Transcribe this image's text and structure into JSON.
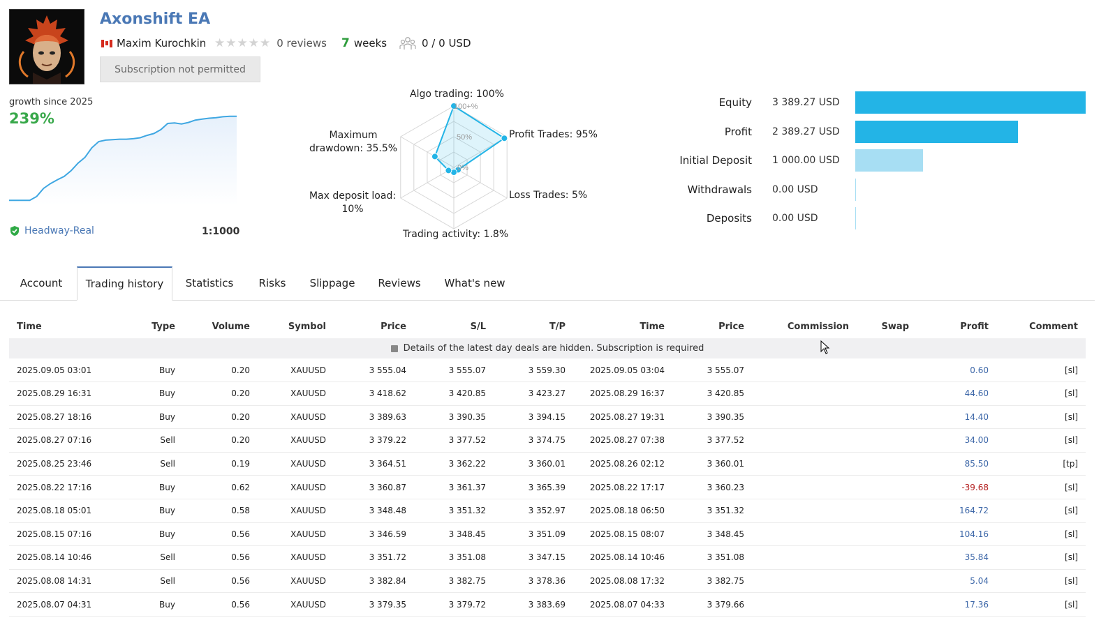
{
  "header": {
    "title": "Axonshift EA",
    "author": "Maxim Kurochkin",
    "reviews": "0 reviews",
    "weeks_num": "7",
    "weeks_label": "weeks",
    "subscribers": "0 / 0 USD",
    "subscription_button": "Subscription not permitted",
    "rating": 0
  },
  "growth": {
    "caption": "growth since 2025",
    "value": "239%",
    "broker": "Headway-Real",
    "leverage": "1:1000"
  },
  "radar": {
    "labels": {
      "algo": "Algo trading: 100%",
      "profit_trades": "Profit Trades: 95%",
      "loss_trades": "Loss Trades: 5%",
      "activity": "Trading activity: 1.8%",
      "deposit_load_1": "Max deposit load:",
      "deposit_load_2": "10%",
      "drawdown_1": "Maximum",
      "drawdown_2": "drawdown: 35.5%"
    },
    "scale": {
      "top": "100+%",
      "mid": "50%",
      "zero": "0%"
    }
  },
  "chart_data": [
    {
      "type": "line",
      "title": "",
      "series": [
        {
          "values": [
            100,
            100,
            100,
            100,
            108,
            125,
            135,
            143,
            150,
            162,
            178,
            190,
            210,
            223,
            226,
            227,
            228,
            228,
            229,
            231,
            236,
            240,
            248,
            261,
            262,
            260,
            263,
            268,
            270,
            272,
            273,
            275,
            276,
            276
          ]
        }
      ]
    },
    {
      "type": "radar",
      "axes": [
        "Algo trading",
        "Profit Trades",
        "Loss Trades",
        "Trading activity",
        "Max deposit load",
        "Maximum drawdown"
      ],
      "values": [
        100,
        95,
        5,
        1.8,
        10,
        35.5
      ]
    },
    {
      "type": "bar",
      "categories": [
        "Equity",
        "Profit",
        "Initial Deposit",
        "Withdrawals",
        "Deposits"
      ],
      "values": [
        3389.27,
        2389.27,
        1000.0,
        0.0,
        0.0
      ]
    }
  ],
  "balance": {
    "items": [
      {
        "label": "Equity",
        "value": "3 389.27 USD",
        "amount": 3389.27,
        "color": "#23b4e6"
      },
      {
        "label": "Profit",
        "value": "2 389.27 USD",
        "amount": 2389.27,
        "color": "#23b4e6"
      },
      {
        "label": "Initial Deposit",
        "value": "1 000.00 USD",
        "amount": 1000.0,
        "color": "#a7def3"
      },
      {
        "label": "Withdrawals",
        "value": "0.00 USD",
        "amount": 0,
        "color": "#a7def3"
      },
      {
        "label": "Deposits",
        "value": "0.00 USD",
        "amount": 0,
        "color": "#a7def3"
      }
    ]
  },
  "tabs": [
    "Account",
    "Trading history",
    "Statistics",
    "Risks",
    "Slippage",
    "Reviews",
    "What's new"
  ],
  "table": {
    "headers": [
      "Time",
      "Type",
      "Volume",
      "Symbol",
      "Price",
      "S/L",
      "T/P",
      "Time",
      "Price",
      "Commission",
      "Swap",
      "Profit",
      "Comment"
    ],
    "notice": "Details of the latest day deals are hidden. Subscription is required",
    "rows": [
      [
        "2025.09.05 03:01",
        "Buy",
        "0.20",
        "XAUUSD",
        "3 555.04",
        "3 555.07",
        "3 559.30",
        "2025.09.05 03:04",
        "3 555.07",
        "",
        "",
        "0.60",
        "[sl]"
      ],
      [
        "2025.08.29 16:31",
        "Buy",
        "0.20",
        "XAUUSD",
        "3 418.62",
        "3 420.85",
        "3 423.27",
        "2025.08.29 16:37",
        "3 420.85",
        "",
        "",
        "44.60",
        "[sl]"
      ],
      [
        "2025.08.27 18:16",
        "Buy",
        "0.20",
        "XAUUSD",
        "3 389.63",
        "3 390.35",
        "3 394.15",
        "2025.08.27 19:31",
        "3 390.35",
        "",
        "",
        "14.40",
        "[sl]"
      ],
      [
        "2025.08.27 07:16",
        "Sell",
        "0.20",
        "XAUUSD",
        "3 379.22",
        "3 377.52",
        "3 374.75",
        "2025.08.27 07:38",
        "3 377.52",
        "",
        "",
        "34.00",
        "[sl]"
      ],
      [
        "2025.08.25 23:46",
        "Sell",
        "0.19",
        "XAUUSD",
        "3 364.51",
        "3 362.22",
        "3 360.01",
        "2025.08.26 02:12",
        "3 360.01",
        "",
        "",
        "85.50",
        "[tp]"
      ],
      [
        "2025.08.22 17:16",
        "Buy",
        "0.62",
        "XAUUSD",
        "3 360.87",
        "3 361.37",
        "3 365.39",
        "2025.08.22 17:17",
        "3 360.23",
        "",
        "",
        "-39.68",
        "[sl]"
      ],
      [
        "2025.08.18 05:01",
        "Buy",
        "0.58",
        "XAUUSD",
        "3 348.48",
        "3 351.32",
        "3 352.97",
        "2025.08.18 06:50",
        "3 351.32",
        "",
        "",
        "164.72",
        "[sl]"
      ],
      [
        "2025.08.15 07:16",
        "Buy",
        "0.56",
        "XAUUSD",
        "3 346.59",
        "3 348.45",
        "3 351.09",
        "2025.08.15 08:07",
        "3 348.45",
        "",
        "",
        "104.16",
        "[sl]"
      ],
      [
        "2025.08.14 10:46",
        "Sell",
        "0.56",
        "XAUUSD",
        "3 351.72",
        "3 351.08",
        "3 347.15",
        "2025.08.14 10:46",
        "3 351.08",
        "",
        "",
        "35.84",
        "[sl]"
      ],
      [
        "2025.08.08 14:31",
        "Sell",
        "0.56",
        "XAUUSD",
        "3 382.84",
        "3 382.75",
        "3 378.36",
        "2025.08.08 17:32",
        "3 382.75",
        "",
        "",
        "5.04",
        "[sl]"
      ],
      [
        "2025.08.07 04:31",
        "Buy",
        "0.56",
        "XAUUSD",
        "3 379.35",
        "3 379.72",
        "3 383.69",
        "2025.08.07 04:33",
        "3 379.66",
        "",
        "",
        "17.36",
        "[sl]"
      ]
    ]
  }
}
